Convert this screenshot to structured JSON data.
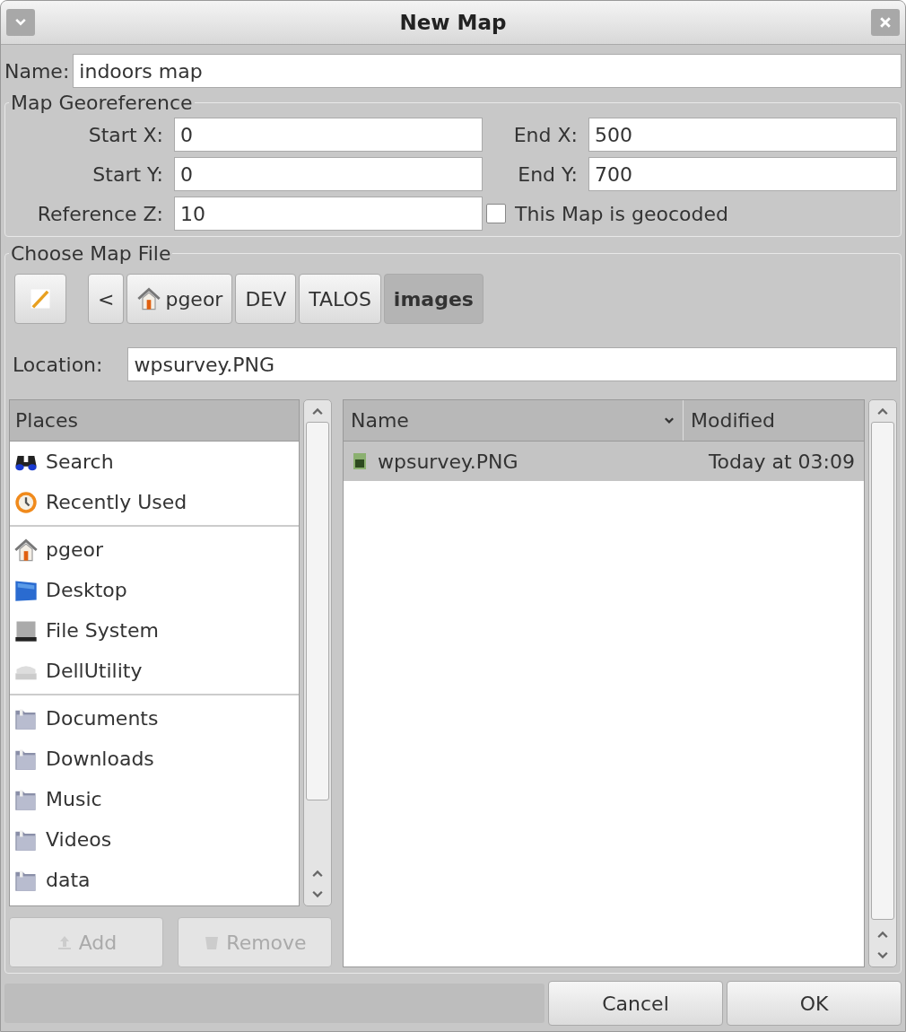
{
  "window": {
    "title": "New Map"
  },
  "name_field": {
    "label": "Name:",
    "value": "indoors map"
  },
  "georeference": {
    "title": "Map Georeference",
    "rows": [
      {
        "left_label": "Start X:",
        "left_value": "0",
        "right_label": "End X:",
        "right_value": "500"
      },
      {
        "left_label": "Start Y:",
        "left_value": "0",
        "right_label": "End Y:",
        "right_value": "700"
      }
    ],
    "reference_z": {
      "label": "Reference Z:",
      "value": "10"
    },
    "geocoded": {
      "label": "This Map is geocoded",
      "checked": false
    }
  },
  "map_file": {
    "title": "Choose Map File",
    "path_back": "<",
    "path": [
      {
        "label": "pgeor",
        "kind": "home",
        "selected": false
      },
      {
        "label": "DEV",
        "kind": "folder",
        "selected": false
      },
      {
        "label": "TALOS",
        "kind": "folder",
        "selected": false
      },
      {
        "label": "images",
        "kind": "folder",
        "selected": true
      }
    ],
    "location": {
      "label": "Location:",
      "value": "wpsurvey.PNG"
    },
    "places": {
      "header": "Places",
      "groups": [
        [
          {
            "label": "Search",
            "kind": "search"
          },
          {
            "label": "Recently Used",
            "kind": "recent"
          }
        ],
        [
          {
            "label": "pgeor",
            "kind": "home"
          },
          {
            "label": "Desktop",
            "kind": "desktop"
          },
          {
            "label": "File System",
            "kind": "drive"
          },
          {
            "label": "DellUtility",
            "kind": "removable"
          }
        ],
        [
          {
            "label": "Documents",
            "kind": "folder"
          },
          {
            "label": "Downloads",
            "kind": "folder"
          },
          {
            "label": "Music",
            "kind": "folder"
          },
          {
            "label": "Videos",
            "kind": "folder"
          },
          {
            "label": "data",
            "kind": "folder"
          }
        ]
      ],
      "buttons": [
        {
          "label": "Add",
          "kind": "add",
          "disabled": true
        },
        {
          "label": "Remove",
          "kind": "remove",
          "disabled": true
        }
      ]
    },
    "files": {
      "columns": [
        {
          "label": "Name",
          "sorted": true
        },
        {
          "label": "Modified",
          "sorted": false
        }
      ],
      "rows": [
        {
          "name": "wpsurvey.PNG",
          "modified": "Today at 03:09",
          "selected": true
        }
      ]
    }
  },
  "buttons": [
    {
      "label": "Cancel"
    },
    {
      "label": "OK"
    }
  ]
}
